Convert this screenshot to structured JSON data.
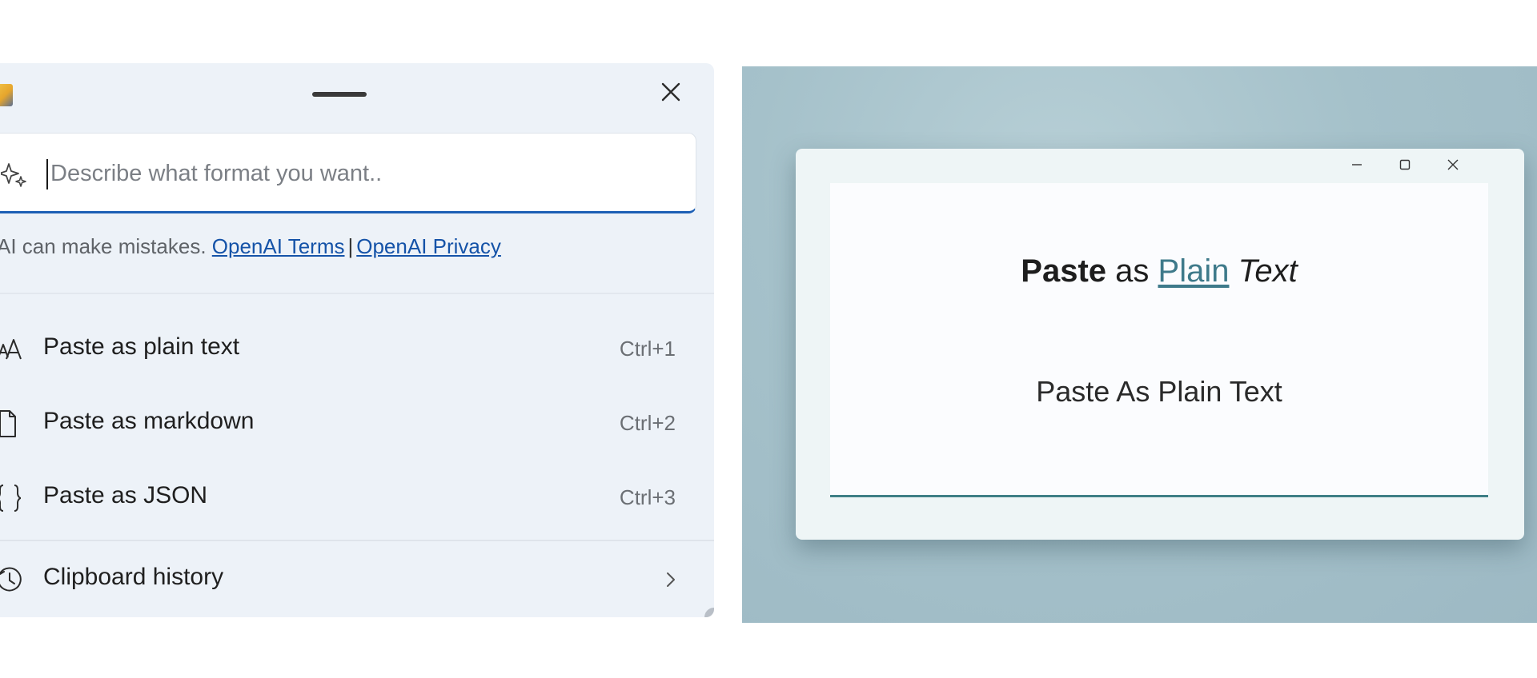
{
  "flyout": {
    "prompt": {
      "placeholder": "Describe what format you want.."
    },
    "disclaimer": {
      "text": "AI can make mistakes.",
      "terms_link": "OpenAI Terms",
      "separator": "|",
      "privacy_link": "OpenAI Privacy"
    },
    "menu": {
      "items": [
        {
          "label": "Paste as plain text",
          "shortcut": "Ctrl+1",
          "icon": "font-plain-text-icon"
        },
        {
          "label": "Paste as markdown",
          "shortcut": "Ctrl+2",
          "icon": "document-icon"
        },
        {
          "label": "Paste as JSON",
          "shortcut": "Ctrl+3",
          "icon": "braces-icon"
        }
      ],
      "history": {
        "label": "Clipboard history",
        "icon": "history-clock-icon"
      }
    },
    "colors": {
      "background": "#edf2f8",
      "accent": "#1c5fb5",
      "link": "#1553a8"
    }
  },
  "preview": {
    "rich_text": {
      "bold": "Paste",
      "normal": "as",
      "link": "Plain",
      "italic": "Text"
    },
    "plain_text": "Paste As Plain Text",
    "colors": {
      "desktop": "#a5c1ca",
      "accent": "#3f7f86"
    }
  }
}
